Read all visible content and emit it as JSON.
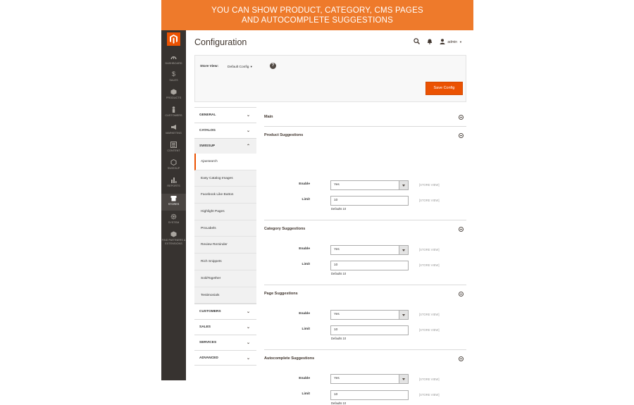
{
  "banner": {
    "line1": "YOU CAN SHOW PRODUCT, CATEGORY, CMS PAGES",
    "line2": "AND AUTOCOMPLETE SUGGESTIONS"
  },
  "nav": [
    {
      "label": "DASHBOARD",
      "icon": "dashboard-icon"
    },
    {
      "label": "SALES",
      "icon": "dollar-icon"
    },
    {
      "label": "PRODUCTS",
      "icon": "cube-icon"
    },
    {
      "label": "CUSTOMERS",
      "icon": "person-icon"
    },
    {
      "label": "MARKETING",
      "icon": "megaphone-icon"
    },
    {
      "label": "CONTENT",
      "icon": "layout-icon"
    },
    {
      "label": "SWISSUP",
      "icon": "hexagon-icon"
    },
    {
      "label": "REPORTS",
      "icon": "bar-chart-icon"
    },
    {
      "label": "STORES",
      "icon": "store-icon"
    },
    {
      "label": "SYSTEM",
      "icon": "gear-icon"
    },
    {
      "label": "FIND PARTNERS & EXTENSIONS",
      "icon": "cubes-icon"
    }
  ],
  "header": {
    "title": "Configuration",
    "user": "admin"
  },
  "store_view": {
    "label": "Store View:",
    "value": "Default Config",
    "help": "?"
  },
  "save_label": "Save Config",
  "tabs": {
    "general": "GENERAL",
    "catalog": "CATALOG",
    "swissup": "SWISSUP",
    "swissup_items": [
      "Ajaxsearch",
      "Easy Catalog Images",
      "Facebook Like Button",
      "Highlight Pages",
      "ProLabels",
      "Review Reminder",
      "Rich Snippets",
      "SoldTogether",
      "Testimonials"
    ],
    "customers": "CUSTOMERS",
    "sales": "SALES",
    "services": "SERVICES",
    "advanced": "ADVANCED"
  },
  "sections": [
    {
      "title": "Main"
    },
    {
      "title": "Product Suggestions",
      "enable_label": "Enable",
      "enable_value": "Yes",
      "limit_label": "Limit",
      "limit_value": "10",
      "note": "Defaults 10",
      "scope": "[STORE VIEW]"
    },
    {
      "title": "Category Suggestions",
      "enable_label": "Enable",
      "enable_value": "Yes",
      "limit_label": "Limit",
      "limit_value": "10",
      "note": "Defaults 10",
      "scope": "[STORE VIEW]"
    },
    {
      "title": "Page Suggestions",
      "enable_label": "Enable",
      "enable_value": "Yes",
      "limit_label": "Limit",
      "limit_value": "10",
      "note": "Defaults 10",
      "scope": "[STORE VIEW]"
    },
    {
      "title": "Autocomplete Suggestions",
      "enable_label": "Enable",
      "enable_value": "Yes",
      "limit_label": "Limit",
      "limit_value": "10",
      "note": "Defaults 10",
      "scope": "[STORE VIEW]"
    }
  ],
  "colors": {
    "accent": "#eb5202",
    "banner": "#ee7a2b",
    "sidebar": "#373330"
  }
}
